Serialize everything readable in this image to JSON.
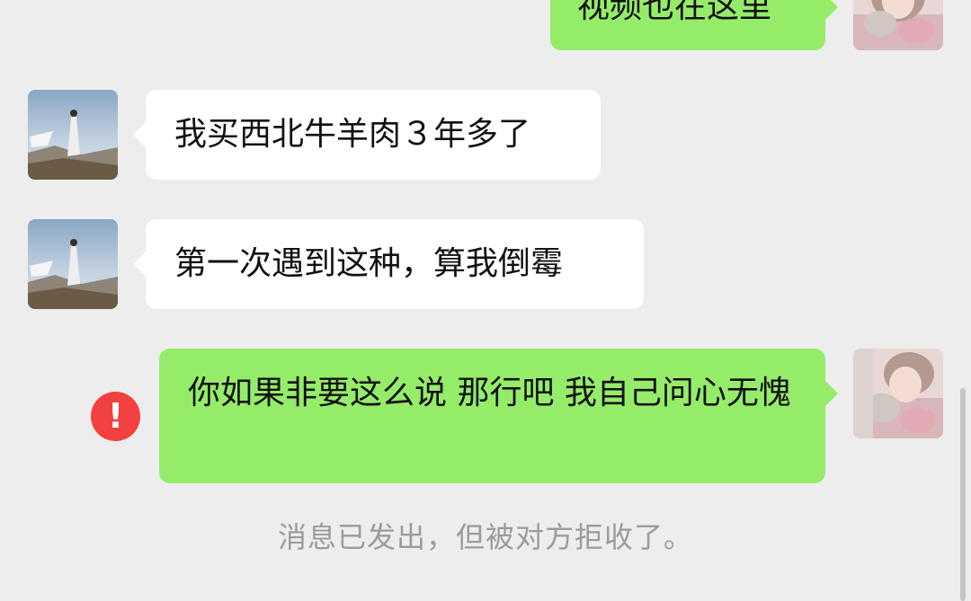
{
  "messages": [
    {
      "text": "视频也在这里"
    },
    {
      "text": "我买西北牛羊肉３年多了"
    },
    {
      "text": "第一次遇到这种，算我倒霉"
    },
    {
      "text": "你如果非要这么说 那行吧 我自己问心无愧"
    }
  ],
  "error_glyph": "!",
  "system_notice": "消息已发出，但被对方拒收了。",
  "colors": {
    "background": "#ededed",
    "outgoing_bubble": "#95ec69",
    "incoming_bubble": "#ffffff",
    "error": "#f2413f",
    "notice_text": "#9b9b9b"
  }
}
